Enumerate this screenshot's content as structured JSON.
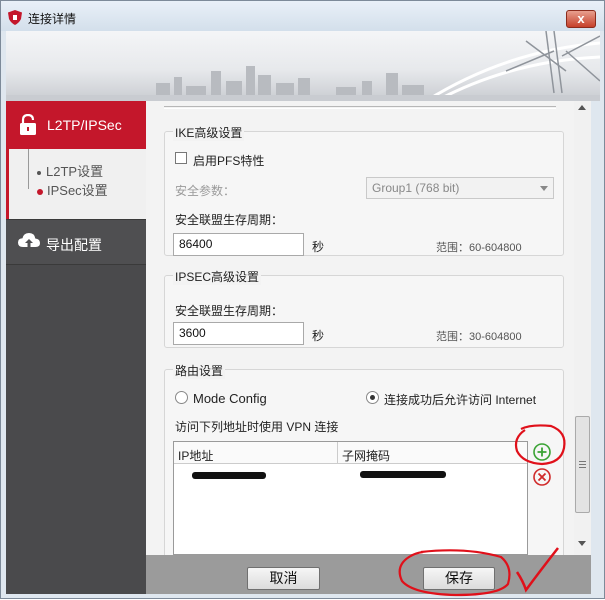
{
  "window": {
    "title": "连接详情",
    "close_label": "x"
  },
  "nav": {
    "l2tp_label": "L2TP/IPSec",
    "sub_items": [
      "L2TP设置",
      "IPSec设置"
    ],
    "export_label": "导出配置"
  },
  "ike": {
    "title": "IKE高级设置",
    "pfs_label": "启用PFS特性",
    "pfs_checked": false,
    "security_param_label": "安全参数：",
    "security_param_value": "Group1 (768 bit)",
    "lifetime_label": "安全联盟生存周期：",
    "lifetime_value": "86400",
    "unit": "秒",
    "range": "范围：60-604800"
  },
  "ipsec": {
    "title": "IPSEC高级设置",
    "lifetime_label": "安全联盟生存周期：",
    "lifetime_value": "3600",
    "unit": "秒",
    "range": "范围：30-604800"
  },
  "routing": {
    "title": "路由设置",
    "option_mode_config": "Mode Config",
    "option_internet": "连接成功后允许访问 Internet",
    "selected": "option_internet",
    "vpn_list_label": "访问下列地址时使用 VPN 连接",
    "columns": [
      "IP地址",
      "子网掩码"
    ]
  },
  "footer": {
    "cancel_label": "取消",
    "save_label": "保存"
  },
  "colors": {
    "accent": "#c4172b",
    "nav_bg": "#4a4a4c",
    "annotation": "#e0101a",
    "add_green": "#3aa334"
  }
}
